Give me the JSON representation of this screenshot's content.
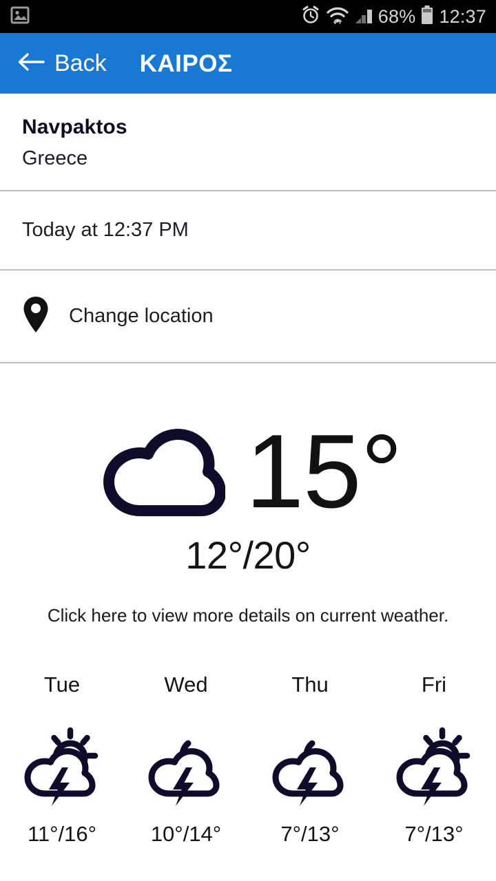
{
  "statusbar": {
    "left_icon": "image-notification-icon",
    "alarm_icon": "alarm-clock-icon",
    "wifi_icon": "wifi-icon",
    "signal_icon": "cellular-signal-icon",
    "battery_icon": "battery-icon",
    "battery_percent": "68%",
    "clock": "12:37"
  },
  "appbar": {
    "back_icon": "arrow-left-icon",
    "back_label": "Back",
    "title": "ΚΑΙΡΟΣ",
    "background_color": "#1878d2"
  },
  "location": {
    "city": "Navpaktos",
    "country": "Greece"
  },
  "observation": {
    "time_text": "Today at 12:37 PM"
  },
  "change_location": {
    "icon": "map-pin-icon",
    "label": "Change location"
  },
  "current_weather": {
    "icon": "cloud-icon",
    "temperature": "15°",
    "high_low": "12°/20°",
    "hint": "Click here to view more details on current weather.",
    "icon_color": "#0d0d2b"
  },
  "forecast": [
    {
      "day": "Tue",
      "icon": "sun-cloud-lightning-icon",
      "temps": "11°/16°"
    },
    {
      "day": "Wed",
      "icon": "moon-cloud-lightning-icon",
      "temps": "10°/14°"
    },
    {
      "day": "Thu",
      "icon": "moon-cloud-lightning-icon",
      "temps": "7°/13°"
    },
    {
      "day": "Fri",
      "icon": "sun-cloud-lightning-icon",
      "temps": "7°/13°"
    }
  ]
}
